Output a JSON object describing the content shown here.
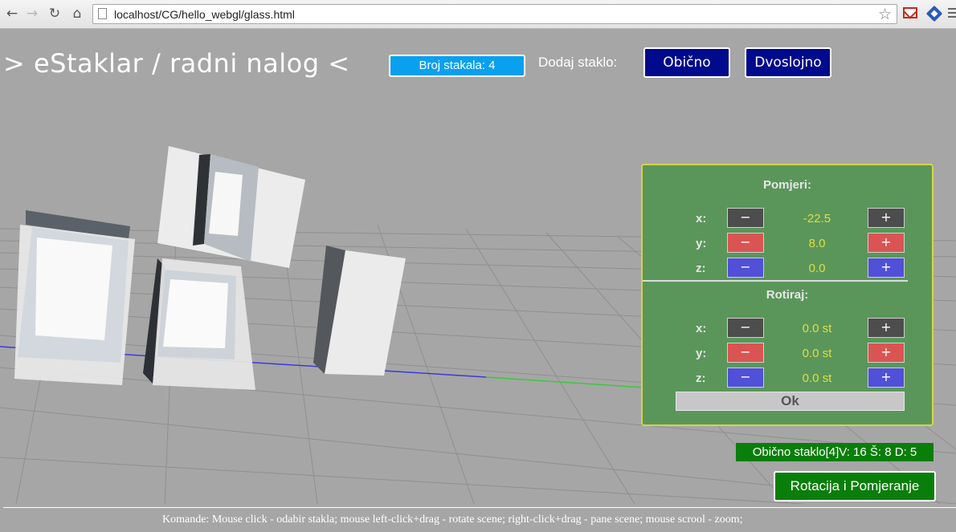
{
  "browser": {
    "url": "localhost/CG/hello_webgl/glass.html",
    "back_icon": "arrow-left",
    "forward_icon": "arrow-right",
    "reload_icon": "reload",
    "home_icon": "home"
  },
  "header": {
    "title": "> eStaklar / radni nalog <",
    "glass_count": "Broj stakala: 4",
    "add_label": "Dodaj staklo:",
    "btn_single": "Obično",
    "btn_double": "Dvoslojno"
  },
  "panel": {
    "move_heading": "Pomjeri:",
    "rotate_heading": "Rotiraj:",
    "minus": "−",
    "plus": "+",
    "axes": {
      "x": "x:",
      "y": "y:",
      "z": "z:"
    },
    "move": {
      "x": "-22.5",
      "y": "8.0",
      "z": "0.0"
    },
    "rotate": {
      "x": "0.0 st",
      "y": "0.0 st",
      "z": "0.0 st"
    },
    "ok": "Ok"
  },
  "status": "Obično staklo[4]V: 16 Š: 8 D: 5",
  "mode_button": "Rotacija i Pomjeranje",
  "footer": "Komande: Mouse click - odabir stakla; mouse left-click+drag - rotate scene; right-click+drag - pane scene; mouse scrool - zoom;",
  "colors": {
    "background": "#a6a6a6",
    "navy": "#000a8c",
    "badge_blue": "#09a0f0",
    "panel_green": "#5a965a",
    "status_green": "#0a7e0a",
    "value_yellow": "#e2dc40"
  }
}
